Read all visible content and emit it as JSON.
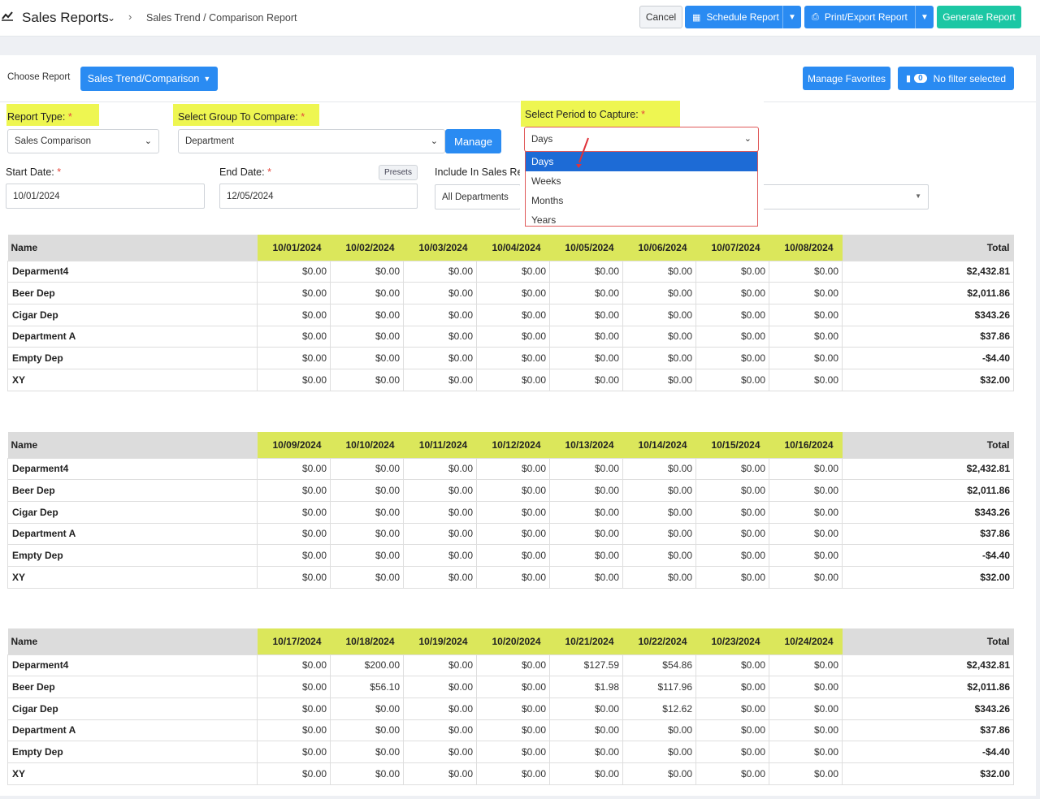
{
  "header": {
    "title": "Sales Reports",
    "breadcrumb": "Sales Trend / Comparison Report",
    "cancel_label": "Cancel",
    "schedule_label": "Schedule Report",
    "print_label": "Print/Export Report",
    "generate_label": "Generate Report"
  },
  "toolbar": {
    "choose_label": "Choose Report",
    "choose_value": "Sales Trend/Comparison",
    "favorites_label": "Manage Favorites",
    "filter_count": "0",
    "filter_label": "No filter selected"
  },
  "form": {
    "report_type_label": "Report Type:",
    "report_type_value": "Sales Comparison",
    "group_label": "Select Group To Compare:",
    "group_value": "Department",
    "manage_label": "Manage",
    "period_label": "Select Period to Capture:",
    "period_value": "Days",
    "period_options": [
      "Days",
      "Weeks",
      "Months",
      "Years"
    ],
    "start_label": "Start Date:",
    "start_value": "10/01/2024",
    "end_label": "End Date:",
    "end_value": "12/05/2024",
    "presets_label": "Presets",
    "include_label": "Include In Sales Re",
    "include_value": "All Departments",
    "required_mark": "*"
  },
  "tables": [
    {
      "name_header": "Name",
      "total_header": "Total",
      "dates": [
        "10/01/2024",
        "10/02/2024",
        "10/03/2024",
        "10/04/2024",
        "10/05/2024",
        "10/06/2024",
        "10/07/2024",
        "10/08/2024"
      ],
      "rows": [
        {
          "name": "Deparment4",
          "values": [
            "$0.00",
            "$0.00",
            "$0.00",
            "$0.00",
            "$0.00",
            "$0.00",
            "$0.00",
            "$0.00"
          ],
          "total": "$2,432.81"
        },
        {
          "name": "Beer Dep",
          "values": [
            "$0.00",
            "$0.00",
            "$0.00",
            "$0.00",
            "$0.00",
            "$0.00",
            "$0.00",
            "$0.00"
          ],
          "total": "$2,011.86"
        },
        {
          "name": "Cigar Dep",
          "values": [
            "$0.00",
            "$0.00",
            "$0.00",
            "$0.00",
            "$0.00",
            "$0.00",
            "$0.00",
            "$0.00"
          ],
          "total": "$343.26"
        },
        {
          "name": "Department A",
          "values": [
            "$0.00",
            "$0.00",
            "$0.00",
            "$0.00",
            "$0.00",
            "$0.00",
            "$0.00",
            "$0.00"
          ],
          "total": "$37.86"
        },
        {
          "name": "Empty Dep",
          "values": [
            "$0.00",
            "$0.00",
            "$0.00",
            "$0.00",
            "$0.00",
            "$0.00",
            "$0.00",
            "$0.00"
          ],
          "total": "-$4.40"
        },
        {
          "name": "XY",
          "values": [
            "$0.00",
            "$0.00",
            "$0.00",
            "$0.00",
            "$0.00",
            "$0.00",
            "$0.00",
            "$0.00"
          ],
          "total": "$32.00"
        }
      ]
    },
    {
      "name_header": "Name",
      "total_header": "Total",
      "dates": [
        "10/09/2024",
        "10/10/2024",
        "10/11/2024",
        "10/12/2024",
        "10/13/2024",
        "10/14/2024",
        "10/15/2024",
        "10/16/2024"
      ],
      "rows": [
        {
          "name": "Deparment4",
          "values": [
            "$0.00",
            "$0.00",
            "$0.00",
            "$0.00",
            "$0.00",
            "$0.00",
            "$0.00",
            "$0.00"
          ],
          "total": "$2,432.81"
        },
        {
          "name": "Beer Dep",
          "values": [
            "$0.00",
            "$0.00",
            "$0.00",
            "$0.00",
            "$0.00",
            "$0.00",
            "$0.00",
            "$0.00"
          ],
          "total": "$2,011.86"
        },
        {
          "name": "Cigar Dep",
          "values": [
            "$0.00",
            "$0.00",
            "$0.00",
            "$0.00",
            "$0.00",
            "$0.00",
            "$0.00",
            "$0.00"
          ],
          "total": "$343.26"
        },
        {
          "name": "Department A",
          "values": [
            "$0.00",
            "$0.00",
            "$0.00",
            "$0.00",
            "$0.00",
            "$0.00",
            "$0.00",
            "$0.00"
          ],
          "total": "$37.86"
        },
        {
          "name": "Empty Dep",
          "values": [
            "$0.00",
            "$0.00",
            "$0.00",
            "$0.00",
            "$0.00",
            "$0.00",
            "$0.00",
            "$0.00"
          ],
          "total": "-$4.40"
        },
        {
          "name": "XY",
          "values": [
            "$0.00",
            "$0.00",
            "$0.00",
            "$0.00",
            "$0.00",
            "$0.00",
            "$0.00",
            "$0.00"
          ],
          "total": "$32.00"
        }
      ]
    },
    {
      "name_header": "Name",
      "total_header": "Total",
      "dates": [
        "10/17/2024",
        "10/18/2024",
        "10/19/2024",
        "10/20/2024",
        "10/21/2024",
        "10/22/2024",
        "10/23/2024",
        "10/24/2024"
      ],
      "rows": [
        {
          "name": "Deparment4",
          "values": [
            "$0.00",
            "$200.00",
            "$0.00",
            "$0.00",
            "$127.59",
            "$54.86",
            "$0.00",
            "$0.00"
          ],
          "total": "$2,432.81"
        },
        {
          "name": "Beer Dep",
          "values": [
            "$0.00",
            "$56.10",
            "$0.00",
            "$0.00",
            "$1.98",
            "$117.96",
            "$0.00",
            "$0.00"
          ],
          "total": "$2,011.86"
        },
        {
          "name": "Cigar Dep",
          "values": [
            "$0.00",
            "$0.00",
            "$0.00",
            "$0.00",
            "$0.00",
            "$12.62",
            "$0.00",
            "$0.00"
          ],
          "total": "$343.26"
        },
        {
          "name": "Department A",
          "values": [
            "$0.00",
            "$0.00",
            "$0.00",
            "$0.00",
            "$0.00",
            "$0.00",
            "$0.00",
            "$0.00"
          ],
          "total": "$37.86"
        },
        {
          "name": "Empty Dep",
          "values": [
            "$0.00",
            "$0.00",
            "$0.00",
            "$0.00",
            "$0.00",
            "$0.00",
            "$0.00",
            "$0.00"
          ],
          "total": "-$4.40"
        },
        {
          "name": "XY",
          "values": [
            "$0.00",
            "$0.00",
            "$0.00",
            "$0.00",
            "$0.00",
            "$0.00",
            "$0.00",
            "$0.00"
          ],
          "total": "$32.00"
        }
      ]
    }
  ],
  "colors": {
    "primary": "#2a8bf2",
    "generate": "#1cc7a4",
    "highlight": "#eef651",
    "dropdown_selected": "#1d6bd6",
    "required": "#e5473c"
  }
}
